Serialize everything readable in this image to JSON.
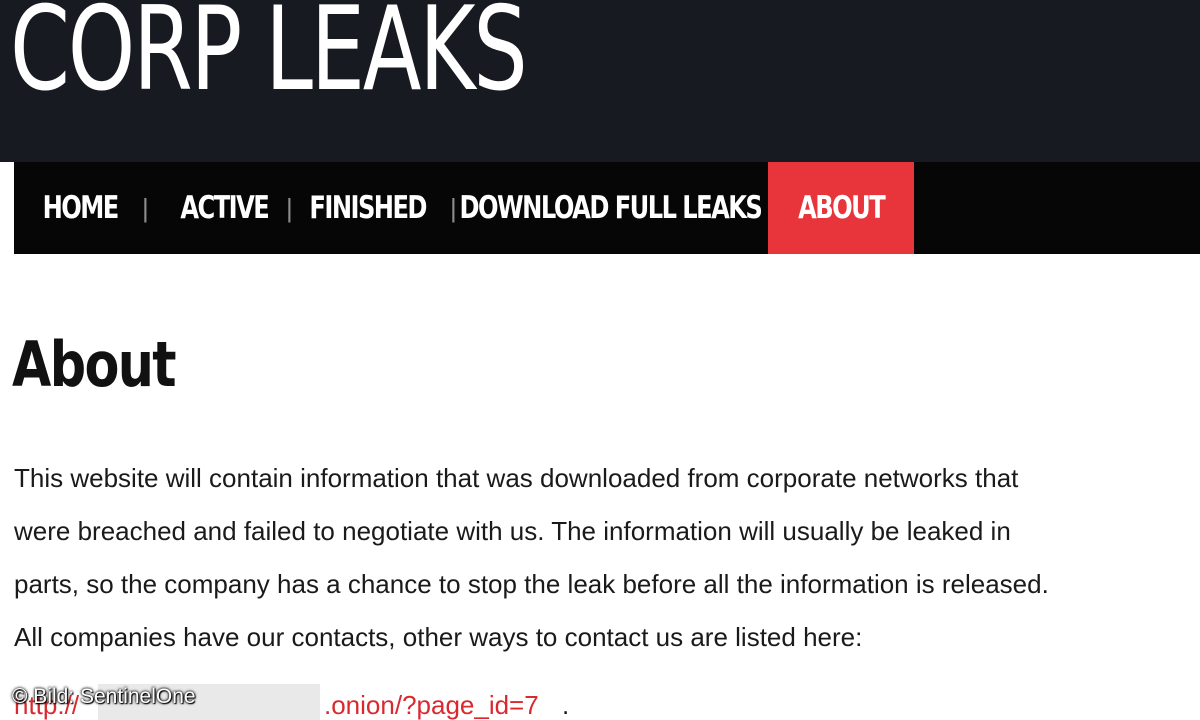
{
  "header": {
    "site_title": "CORP LEAKS"
  },
  "nav": {
    "items": [
      {
        "label": "HOME"
      },
      {
        "label": "ACTIVE"
      },
      {
        "label": "FINISHED"
      },
      {
        "label": "DOWNLOAD FULL LEAKS"
      },
      {
        "label": "ABOUT"
      }
    ],
    "separator": "|",
    "active_color": "#e8343b"
  },
  "page": {
    "heading": "About",
    "paragraph_lines": [
      "This website will contain information that was downloaded from corporate networks that",
      "were breached and failed to negotiate with us. The information will usually be leaked in",
      "parts, so the company has a chance to stop the leak before all the information is released.",
      "All companies have our contacts, other ways to contact us are listed here:"
    ],
    "link": {
      "prefix": "http://",
      "suffix": ".onion/?page_id=7",
      "trailing": "."
    }
  },
  "credit": "© Bild: SentinelOne",
  "colors": {
    "header_bg": "#171a21",
    "nav_bg": "#060607",
    "link": "#d9292f"
  }
}
